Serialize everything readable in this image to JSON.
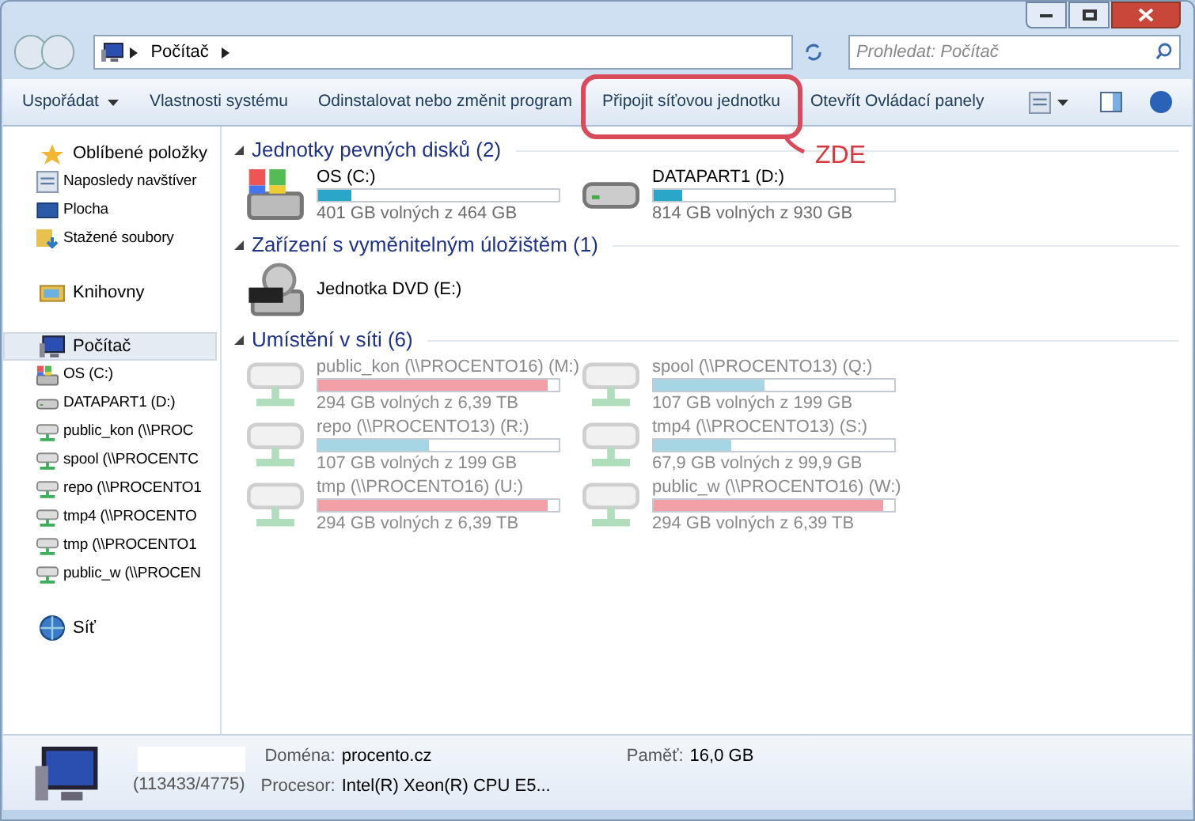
{
  "address": {
    "path": [
      "Počítač"
    ],
    "search_placeholder": "Prohledat: Počítač"
  },
  "toolbar": [
    {
      "label": "Uspořádat",
      "dropdown": true,
      "annotated": false
    },
    {
      "label": "Vlastnosti systému",
      "dropdown": false,
      "annotated": false
    },
    {
      "label": "Odinstalovat nebo změnit program",
      "dropdown": false,
      "annotated": false
    },
    {
      "label": "Připojit síťovou jednotku",
      "dropdown": false,
      "annotated": true
    },
    {
      "label": "Otevřít Ovládací panely",
      "dropdown": false,
      "annotated": false
    }
  ],
  "annotation": {
    "label": "ZDE"
  },
  "sidebar": [
    {
      "label": "Oblíbené položky",
      "kind": "star",
      "selected": false,
      "children": [
        {
          "label": "Naposledy navštíver",
          "kind": "recent"
        },
        {
          "label": "Plocha",
          "kind": "desktop"
        },
        {
          "label": "Stažené soubory",
          "kind": "downloads"
        }
      ]
    },
    {
      "label": "Knihovny",
      "kind": "library",
      "selected": false
    },
    {
      "label": "Počítač",
      "kind": "computer",
      "selected": true,
      "children": [
        {
          "label": "OS (C:)",
          "kind": "osdrive"
        },
        {
          "label": "DATAPART1 (D:)",
          "kind": "drive"
        },
        {
          "label": "public_kon (\\\\PROC",
          "kind": "net"
        },
        {
          "label": "spool (\\\\PROCENTC",
          "kind": "net"
        },
        {
          "label": "repo (\\\\PROCENTO1",
          "kind": "net"
        },
        {
          "label": "tmp4 (\\\\PROCENTO",
          "kind": "net"
        },
        {
          "label": "tmp (\\\\PROCENTO1",
          "kind": "net"
        },
        {
          "label": "public_w (\\\\PROCEN",
          "kind": "net"
        }
      ]
    },
    {
      "label": "Síť",
      "kind": "network",
      "selected": false
    }
  ],
  "groups": [
    {
      "title": "Jednotky pevných disků (2)",
      "items": [
        {
          "name": "OS (C:)",
          "kind": "osdrive",
          "level": 0.14,
          "color": "#2aa6c8",
          "free": "401 GB volných z 464 GB",
          "faded": false
        },
        {
          "name": "DATAPART1 (D:)",
          "kind": "drive",
          "level": 0.12,
          "color": "#2aa6c8",
          "free": "814 GB volných z 930 GB",
          "faded": false
        }
      ]
    },
    {
      "title": "Zařízení s vyměnitelným úložištěm (1)",
      "items": [
        {
          "name": "Jednotka DVD (E:)",
          "kind": "dvd",
          "faded": false
        }
      ]
    },
    {
      "title": "Umístění v síti (6)",
      "items": [
        {
          "name": "public_kon (\\\\PROCENTO16) (M:)",
          "kind": "net",
          "level": 0.955,
          "color": "#f0a0a6",
          "free": "294 GB volných z 6,39 TB",
          "faded": true
        },
        {
          "name": "spool (\\\\PROCENTO13) (Q:)",
          "kind": "net",
          "level": 0.46,
          "color": "#a6d6e4",
          "free": "107 GB volných z 199 GB",
          "faded": true
        },
        {
          "name": "repo (\\\\PROCENTO13) (R:)",
          "kind": "net",
          "level": 0.46,
          "color": "#a6d6e4",
          "free": "107 GB volných z 199 GB",
          "faded": true
        },
        {
          "name": "tmp4 (\\\\PROCENTO13) (S:)",
          "kind": "net",
          "level": 0.32,
          "color": "#a6d6e4",
          "free": "67,9 GB volných z 99,9 GB",
          "faded": true
        },
        {
          "name": "tmp (\\\\PROCENTO16) (U:)",
          "kind": "net",
          "level": 0.955,
          "color": "#f0a0a6",
          "free": "294 GB volných z 6,39 TB",
          "faded": true
        },
        {
          "name": "public_w (\\\\PROCENTO16) (W:)",
          "kind": "net",
          "level": 0.955,
          "color": "#f0a0a6",
          "free": "294 GB volných z 6,39 TB",
          "faded": true
        }
      ]
    }
  ],
  "details": {
    "computer_suffix": "(113433/4775)",
    "fields": [
      {
        "label": "Doména:",
        "value": "procento.cz"
      },
      {
        "label": "Paměť:",
        "value": "16,0 GB"
      },
      {
        "label": "Procesor:",
        "value": "Intel(R) Xeon(R) CPU E5..."
      }
    ]
  }
}
